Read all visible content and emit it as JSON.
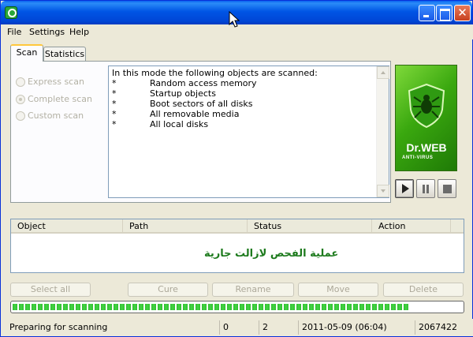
{
  "menu": {
    "file": "File",
    "settings": "Settings",
    "help": "Help"
  },
  "tabs": {
    "scan": "Scan",
    "statistics": "Statistics"
  },
  "scan_modes": [
    {
      "label": "Express scan",
      "selected": false
    },
    {
      "label": "Complete scan",
      "selected": true
    },
    {
      "label": "Custom scan",
      "selected": false
    }
  ],
  "description": {
    "intro": "In this mode the following objects are scanned:",
    "bullet": "*",
    "items": [
      "Random access memory",
      "Startup objects",
      "Boot sectors of all disks",
      "All removable media",
      "All local disks"
    ]
  },
  "logo": {
    "name": "Dr.WEB",
    "sub": "ANTI-VIRUS",
    "color": "#3aa80f"
  },
  "controls": {
    "play": "play-icon",
    "pause": "pause-icon",
    "stop": "stop-icon"
  },
  "results": {
    "columns": [
      "Object",
      "Path",
      "Status",
      "Action"
    ],
    "overlay_text": "عملية الفحص لازالت جارية"
  },
  "actions": {
    "select_all": "Select all",
    "cure": "Cure",
    "rename": "Rename",
    "move": "Move",
    "delete": "Delete"
  },
  "progress": {
    "fraction": 0.88,
    "color": "#2fbf2f"
  },
  "status": {
    "message": "Preparing for scanning",
    "count1": "0",
    "count2": "2",
    "datetime": "2011-05-09 (06:04)",
    "records": "2067422"
  }
}
